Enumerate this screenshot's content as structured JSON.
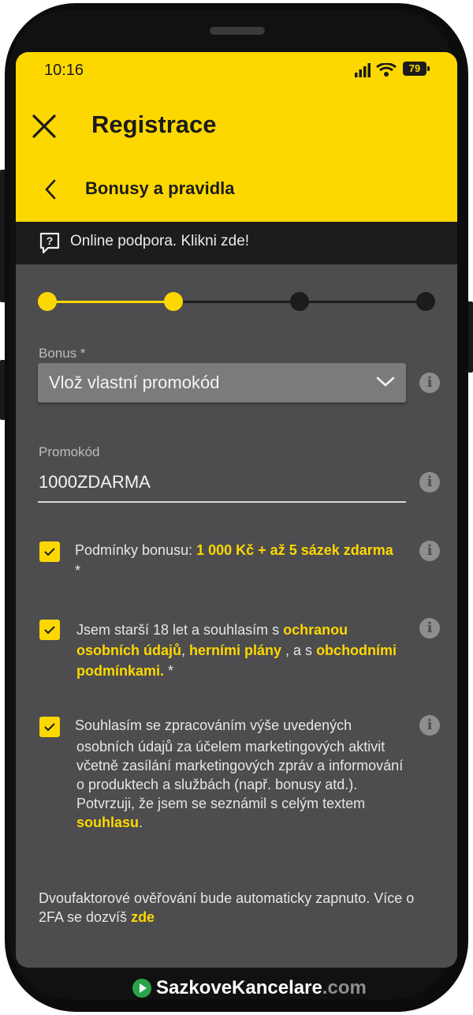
{
  "status_bar": {
    "time": "10:16",
    "battery": "79"
  },
  "header": {
    "title": "Registrace",
    "subtitle": "Bonusy a pravidla"
  },
  "support": {
    "text": "Online podpora. Klikni zde!"
  },
  "stepper": {
    "current_step": 2,
    "total_steps": 4
  },
  "bonus": {
    "label": "Bonus *",
    "selected": "Vlož vlastní promokód"
  },
  "promo": {
    "label": "Promokód",
    "value": "1000ZDARMA"
  },
  "checks": {
    "bonus_terms": {
      "prefix": "Podmínky bonusu:",
      "link": "1 000 Kč + až 5 sázek zdarma",
      "suffix": " *",
      "checked": true
    },
    "age_consent": {
      "prefix": "Jsem starší 18 let a souhlasím s ",
      "link1": "ochranou osobních údajů",
      "sep1": ", ",
      "link2": "herními plány",
      "sep2": " , a s ",
      "link3": "obchodními podmínkami.",
      "suffix": " *",
      "checked": true
    },
    "marketing": {
      "line1": "Souhlasím se zpracováním výše uvedených",
      "body": "osobních údajů za účelem marketingových aktivit včetně zasílání marketingových zpráv a informování o produktech a službách (např. bonusy atd.).",
      "confirm": "Potvrzuji, že jsem se seznámil s celým textem ",
      "link": "souhlasu",
      "end": ".",
      "checked": true
    }
  },
  "twofa": {
    "text": "Dvoufaktorové ověřování bude automaticky zapnuto. Více o 2FA se dozvíš ",
    "link": "zde"
  },
  "watermark": {
    "name": "SazkoveKancelare",
    "tld": ".com"
  },
  "colors": {
    "accent": "#fdd800",
    "background": "#4d4c4f",
    "support_bar": "#1c1c1e"
  }
}
